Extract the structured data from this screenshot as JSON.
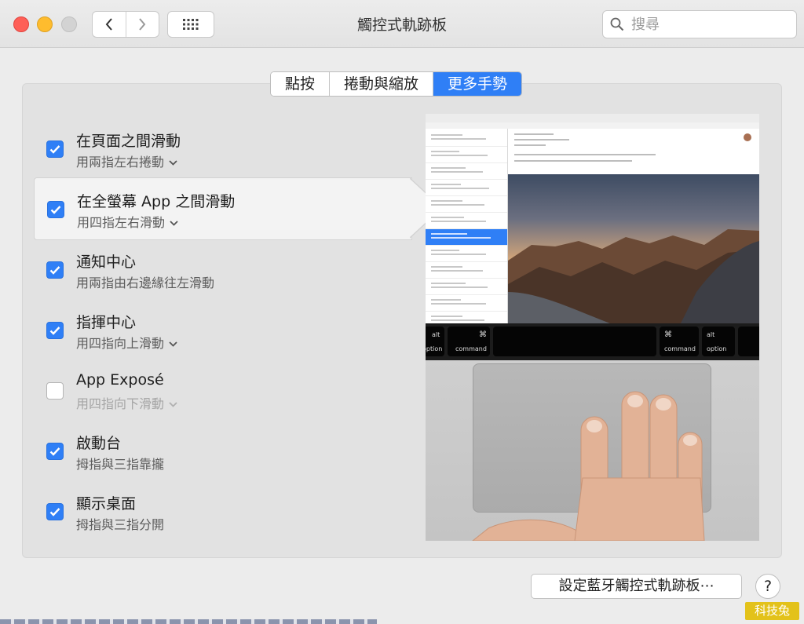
{
  "window": {
    "title": "觸控式軌跡板",
    "search_placeholder": "搜尋"
  },
  "tabs": [
    {
      "label": "點按",
      "active": false
    },
    {
      "label": "捲動與縮放",
      "active": false
    },
    {
      "label": "更多手勢",
      "active": true
    }
  ],
  "gestures": [
    {
      "title": "在頁面之間滑動",
      "subtitle": "用兩指左右捲動",
      "checked": true,
      "has_menu": true
    },
    {
      "title": "在全螢幕 App 之間滑動",
      "subtitle": "用四指左右滑動",
      "checked": true,
      "has_menu": true,
      "selected": true
    },
    {
      "title": "通知中心",
      "subtitle": "用兩指由右邊緣往左滑動",
      "checked": true,
      "has_menu": false
    },
    {
      "title": "指揮中心",
      "subtitle": "用四指向上滑動",
      "checked": true,
      "has_menu": true
    },
    {
      "title": "App Exposé",
      "subtitle": "用四指向下滑動",
      "checked": false,
      "has_menu": true
    },
    {
      "title": "啟動台",
      "subtitle": "拇指與三指靠攏",
      "checked": true,
      "has_menu": false
    },
    {
      "title": "顯示桌面",
      "subtitle": "拇指與三指分開",
      "checked": true,
      "has_menu": false
    }
  ],
  "preview": {
    "keys": {
      "option_left": "option",
      "alt_left": "alt",
      "command_left": "command",
      "command_symbol": "⌘",
      "command_right": "command",
      "option_right": "option",
      "alt_right": "alt"
    }
  },
  "footer": {
    "bluetooth_button": "設定藍牙觸控式軌跡板⋯",
    "help_label": "?"
  },
  "watermark": "科技兔",
  "colors": {
    "accent": "#2f7ff6",
    "window_bg": "#ececec",
    "panel_bg": "#e2e2e2"
  }
}
